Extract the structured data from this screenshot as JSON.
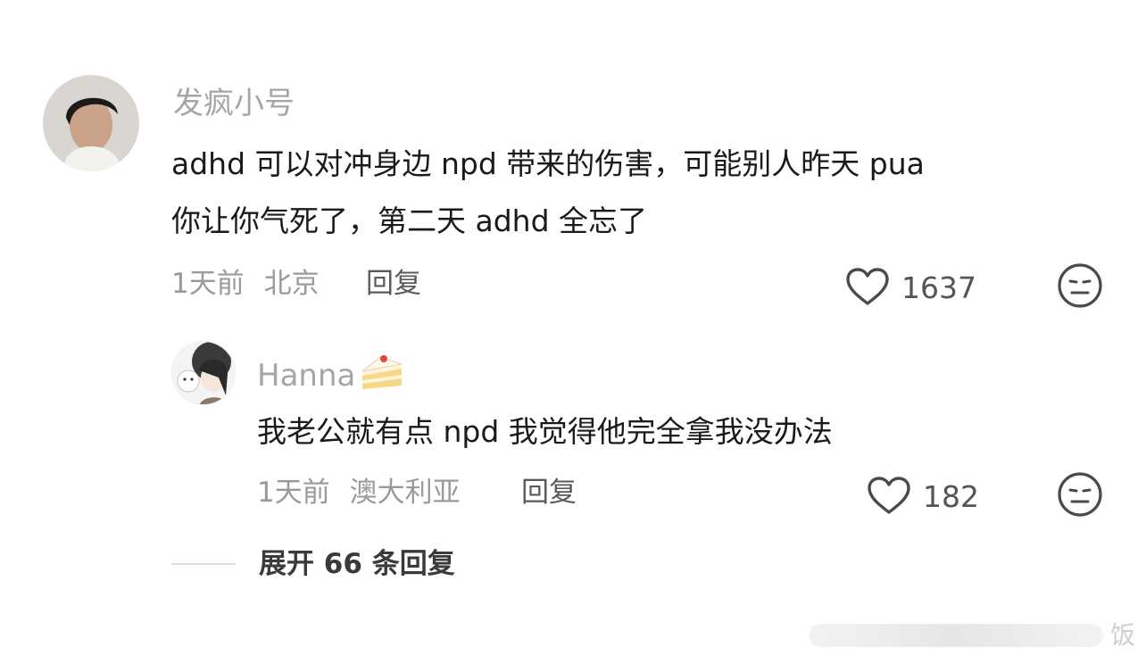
{
  "comment": {
    "username": "发疯小号",
    "text_line1": "adhd 可以对冲身边 npd 带来的伤害，可能别人昨天 pua",
    "text_line2": "你让你气死了，第二天 adhd 全忘了",
    "time": "1天前",
    "location": "北京",
    "reply_label": "回复",
    "likes": "1637"
  },
  "reply": {
    "username": "Hanna",
    "username_emoji": "🍰",
    "text": "我老公就有点 npd 我觉得他完全拿我没办法",
    "time": "1天前",
    "location": "澳大利亚",
    "reply_label": "回复",
    "likes": "182"
  },
  "expand": {
    "label": "展开 66 条回复"
  },
  "watermark": {
    "text": "饭"
  },
  "icons": {
    "like": "heart-outline-icon",
    "dislike": "meh-face-icon"
  }
}
